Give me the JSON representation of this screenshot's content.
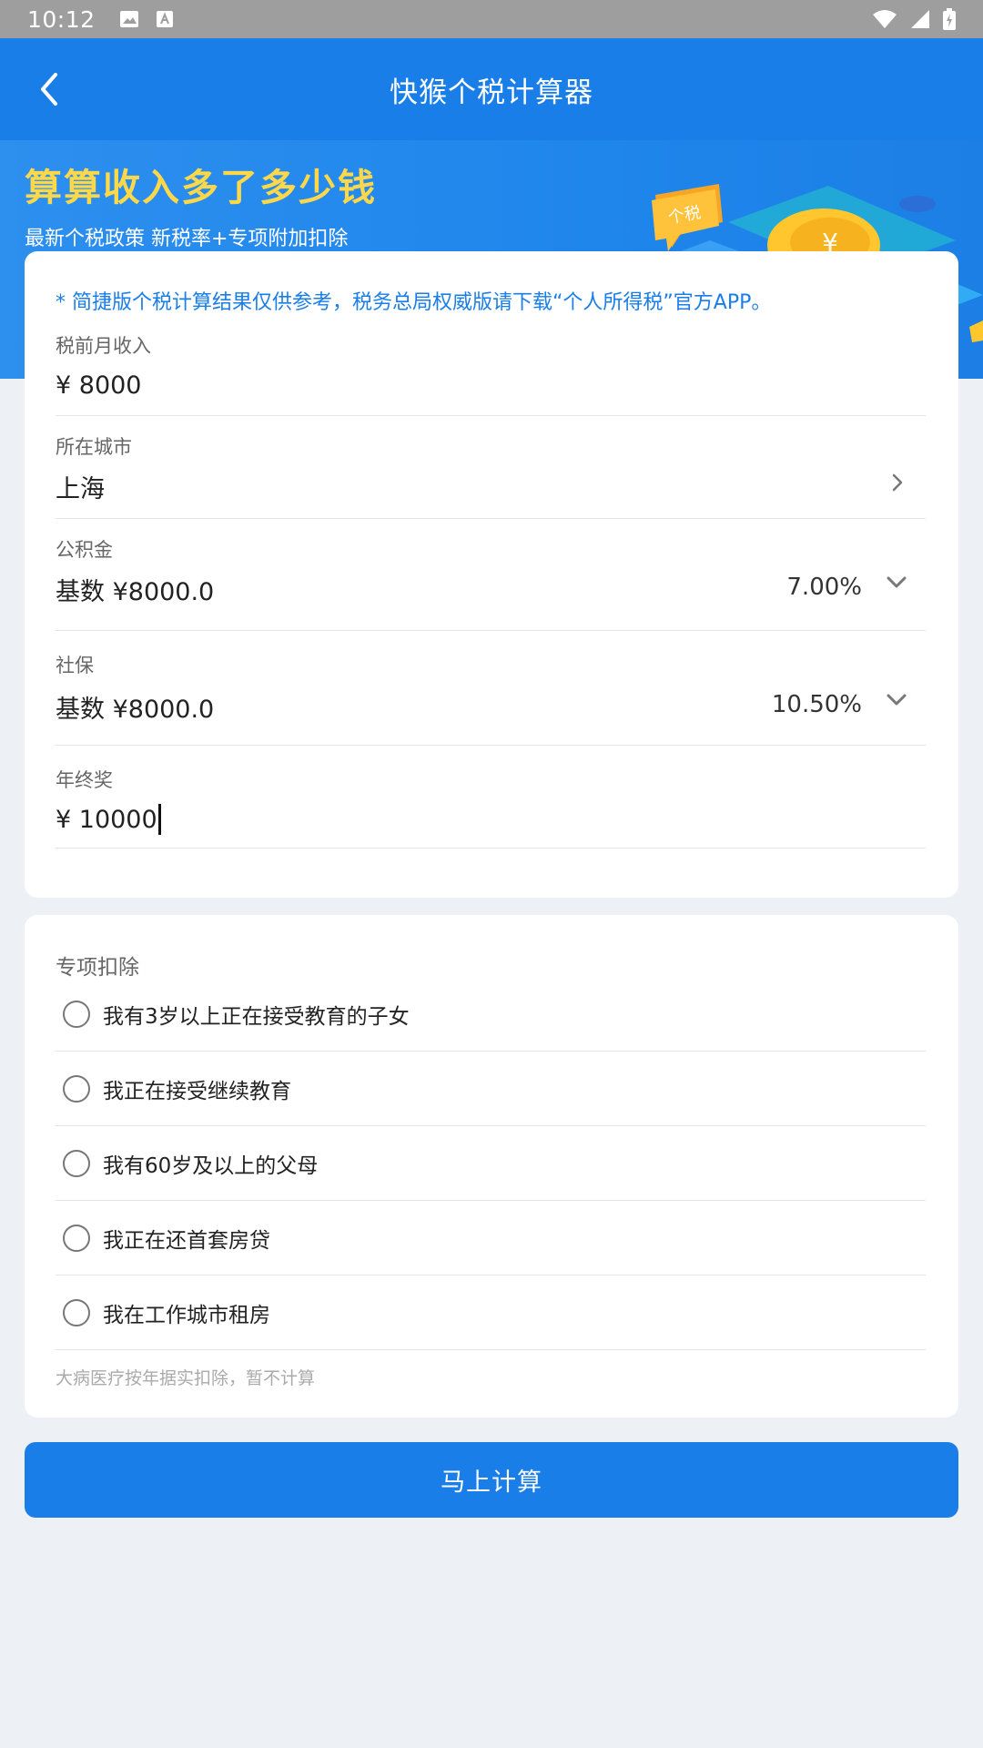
{
  "status_bar": {
    "time": "10:12"
  },
  "app_bar": {
    "title": "快猴个税计算器"
  },
  "banner": {
    "headline": "算算收入多了多少钱",
    "subtitle": "最新个税政策 新税率+专项附加扣除",
    "art_bubble_text": "个税",
    "art_coin_symbol": "¥"
  },
  "notice": "* 简捷版个税计算结果仅供参考，税务总局权威版请下载“个人所得税”官方APP。",
  "income": {
    "label": "税前月收入",
    "value": "¥ 8000"
  },
  "city": {
    "label": "所在城市",
    "value": "上海"
  },
  "fund": {
    "label": "公积金",
    "base": "基数 ¥8000.0",
    "rate": "7.00%"
  },
  "social": {
    "label": "社保",
    "base": "基数 ¥8000.0",
    "rate": "10.50%"
  },
  "bonus": {
    "label": "年终奖",
    "value": "¥ 10000"
  },
  "deductions": {
    "title": "专项扣除",
    "options": [
      "我有3岁以上正在接受教育的子女",
      "我正在接受继续教育",
      "我有60岁及以上的父母",
      "我正在还首套房贷",
      "我在工作城市租房"
    ],
    "note": "大病医疗按年据实扣除，暂不计算"
  },
  "calc_button": "马上计算",
  "colors": {
    "primary": "#1a7ee8",
    "headline": "#ffd84a",
    "background": "#edf0f4"
  }
}
